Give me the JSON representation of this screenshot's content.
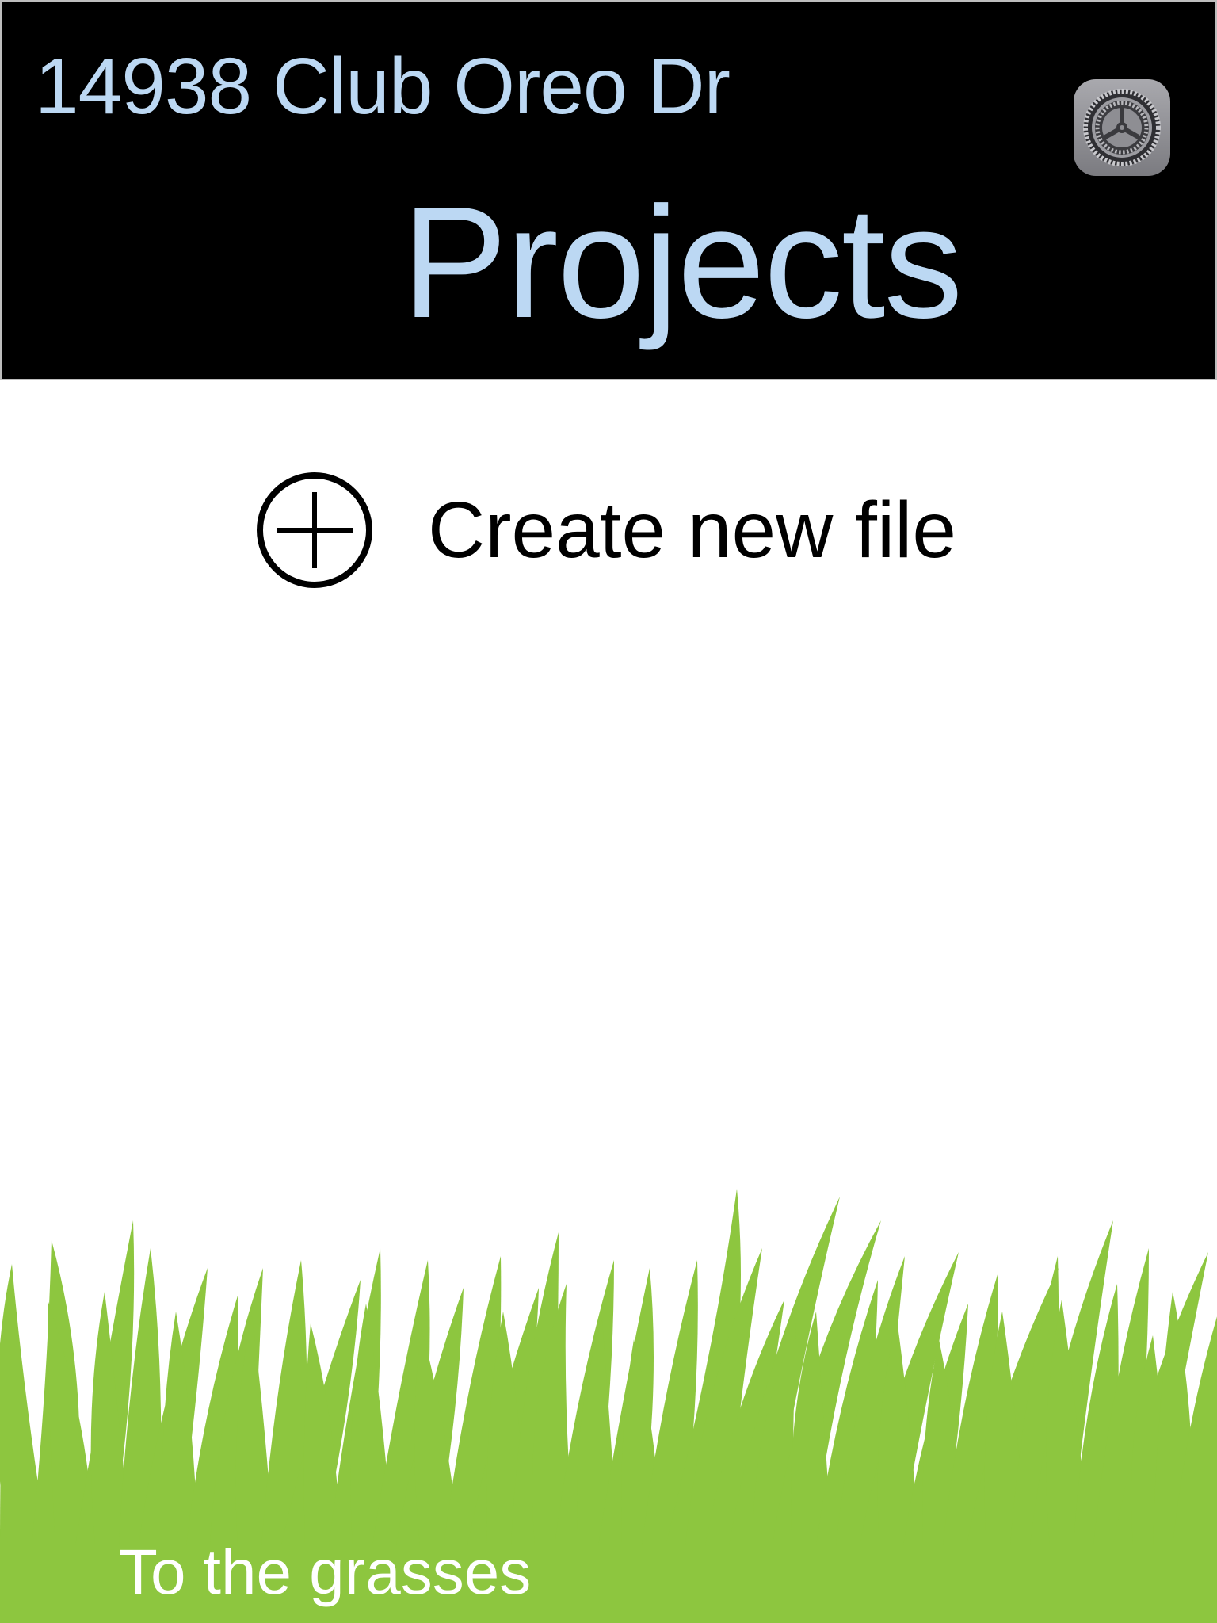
{
  "header": {
    "address": "14938 Club Oreo Dr",
    "title": "Projects",
    "settings_icon": "settings-gear-icon",
    "text_color": "#bcd8f3",
    "background": "#000000"
  },
  "main": {
    "create_label": "Create new file",
    "create_icon": "circle-plus-icon"
  },
  "footer": {
    "grass_link": "To the grasses",
    "grass_color": "#8dc63f",
    "text_color": "#ffffff"
  }
}
